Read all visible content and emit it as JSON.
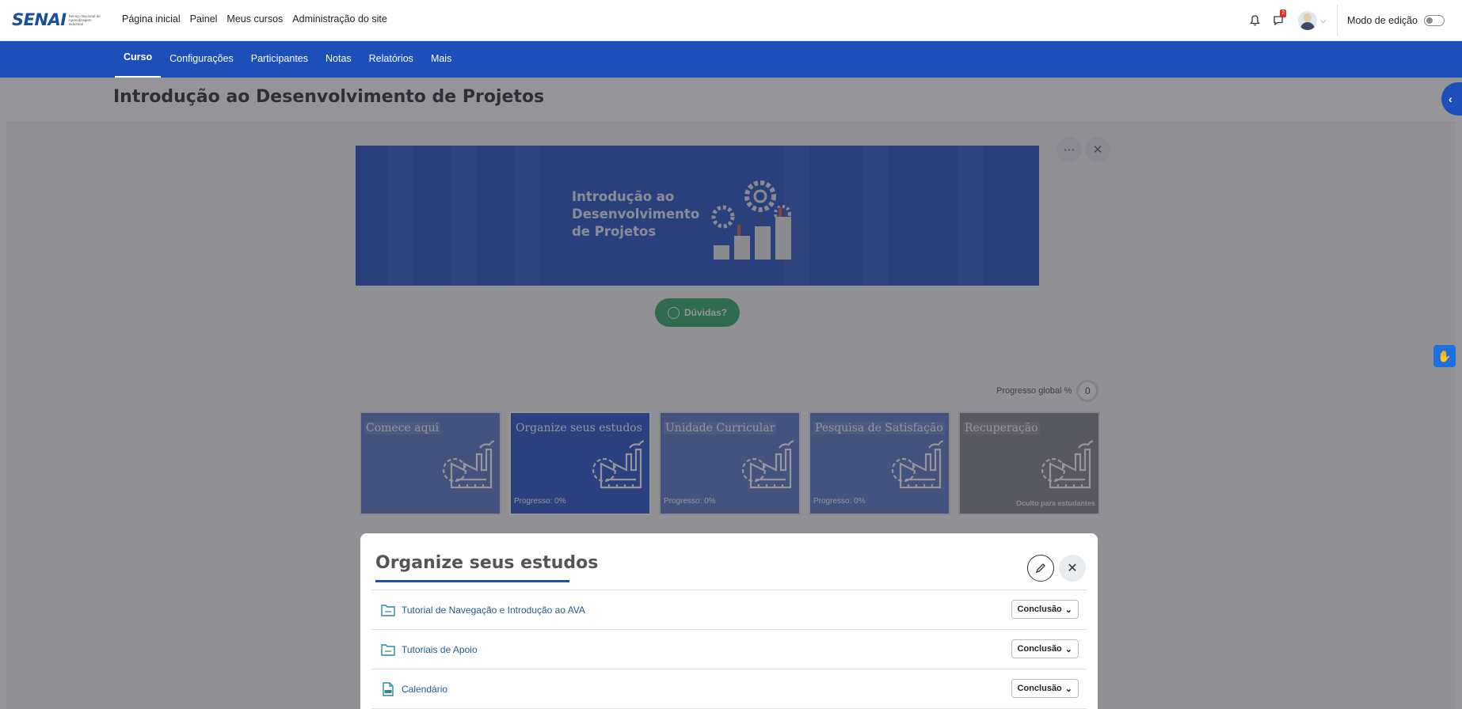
{
  "brand": {
    "logo_text": "SENAI",
    "logo_subtext": "Serviço Nacional de Aprendizagem Industrial"
  },
  "topnav": {
    "items": [
      "Página inicial",
      "Painel",
      "Meus cursos",
      "Administração do site"
    ],
    "notification_count": "2",
    "edit_mode_label": "Modo de edição",
    "edit_mode_on": false
  },
  "secnav": {
    "items": [
      "Curso",
      "Configurações",
      "Participantes",
      "Notas",
      "Relatórios",
      "Mais"
    ],
    "active": "Curso"
  },
  "page": {
    "title": "Introdução ao Desenvolvimento de Projetos"
  },
  "banner": {
    "text": "Introdução ao Desenvolvimento de Projetos"
  },
  "help_button": {
    "label": "Dúvidas?"
  },
  "progress_global": {
    "label": "Progresso global %",
    "value": "0"
  },
  "tiles": [
    {
      "title": "Comece aqui",
      "progress": "",
      "note": ""
    },
    {
      "title": "Organize seus estudos",
      "progress": "Progresso: 0%",
      "note": ""
    },
    {
      "title": "Unidade Curricular",
      "progress": "Progresso: 0%",
      "note": ""
    },
    {
      "title": "Pesquisa de Satisfação",
      "progress": "Progresso: 0%",
      "note": ""
    },
    {
      "title": "Recuperação",
      "progress": "",
      "note": "Oculto para estudantes"
    }
  ],
  "modal": {
    "title": "Organize seus estudos",
    "rows": [
      {
        "label": "Tutorial de Navegação e Introdução ao AVA",
        "icon": "folder-icon",
        "button": "Conclusão"
      },
      {
        "label": "Tutoriais de Apoio",
        "icon": "folder-icon",
        "button": "Conclusão"
      },
      {
        "label": "Calendário",
        "icon": "pdf-icon",
        "button": "Conclusão"
      }
    ]
  },
  "colors": {
    "brand_blue": "#1d4fb8",
    "tile_blue": "#4f6fc0",
    "tile_active": "#1a45c8",
    "whatsapp_green": "#21a558"
  }
}
